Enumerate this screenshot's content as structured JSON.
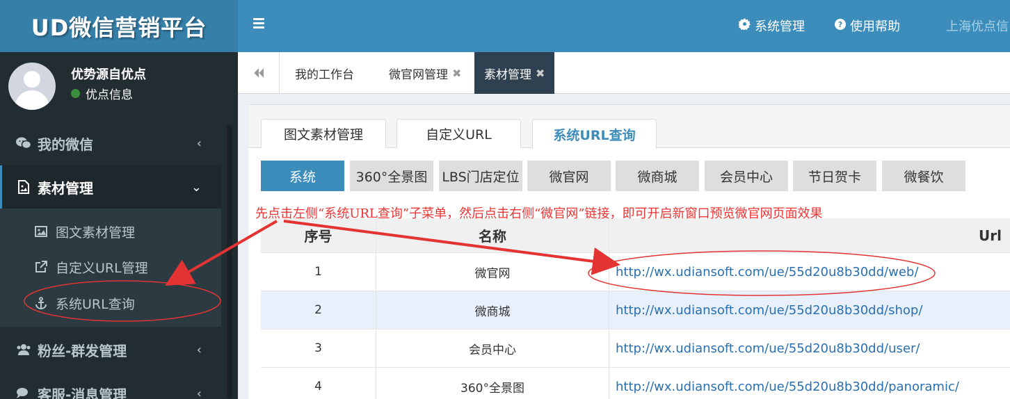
{
  "sidebar": {
    "logo": "UD微信营销平台",
    "user_name": "优势源自优点",
    "user_status": "优点信息",
    "menu": [
      {
        "label": "我的微信",
        "icon": "wechat-icon",
        "arrow": "‹"
      },
      {
        "label": "素材管理",
        "icon": "file-image-icon",
        "arrow": "⌄"
      },
      {
        "label": "粉丝-群发管理",
        "icon": "users-icon",
        "arrow": "‹"
      },
      {
        "label": "客服-消息管理",
        "icon": "comments-icon",
        "arrow": "‹"
      }
    ],
    "submenu": [
      {
        "label": "图文素材管理",
        "icon": "image-icon"
      },
      {
        "label": "自定义URL管理",
        "icon": "external-link-icon"
      },
      {
        "label": "系统URL查询",
        "icon": "anchor-icon"
      }
    ]
  },
  "header": {
    "system_label": "系统管理",
    "help_label": "使用帮助",
    "company": "上海优点信"
  },
  "tabs": [
    {
      "label": "我的工作台"
    },
    {
      "label": "微官网管理",
      "close": "✖"
    },
    {
      "label": "素材管理",
      "close": "✖"
    }
  ],
  "content_tabs": [
    "图文素材管理",
    "自定义URL",
    "系统URL查询"
  ],
  "categories": [
    "系统",
    "360°全景图",
    "LBS门店定位",
    "微官网",
    "微商城",
    "会员中心",
    "节日贺卡",
    "微餐饮"
  ],
  "note": "先点击左侧“系统URL查询”子菜单，然后点击右侧“微官网”链接，即可开启新窗口预览微官网页面效果",
  "table": {
    "headers": [
      "序号",
      "名称",
      "Url"
    ],
    "rows": [
      {
        "num": "1",
        "name": "微官网",
        "url": "http://wx.udiansoft.com/ue/55d20u8b30dd/web/"
      },
      {
        "num": "2",
        "name": "微商城",
        "url": "http://wx.udiansoft.com/ue/55d20u8b30dd/shop/"
      },
      {
        "num": "3",
        "name": "会员中心",
        "url": "http://wx.udiansoft.com/ue/55d20u8b30dd/user/"
      },
      {
        "num": "4",
        "name": "360°全景图",
        "url": "http://wx.udiansoft.com/ue/55d20u8b30dd/panoramic/"
      }
    ]
  },
  "colors": {
    "header": "#3c8dbc",
    "logo_bg": "#367fa9",
    "sidebar": "#222d32",
    "annotation": "#e33333",
    "link": "#2a6fb0"
  }
}
